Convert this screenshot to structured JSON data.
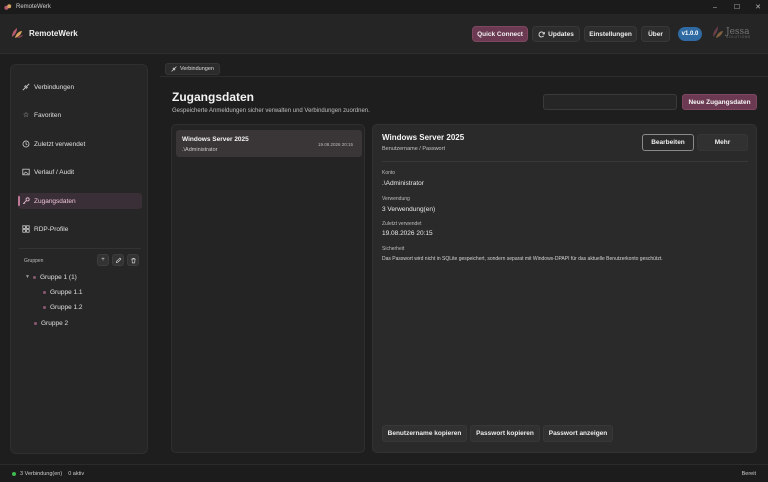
{
  "window": {
    "title": "RemoteWerk",
    "minimize": "–",
    "maximize": "☐",
    "close": "✕"
  },
  "header": {
    "brand": "RemoteWerk",
    "quick_connect": "Quick Connect",
    "updates": "Updates",
    "settings": "Einstellungen",
    "about": "Über",
    "version": "v1.0.0",
    "partner_logo_text": "Jessa",
    "partner_logo_sub": "SOLUTIONS"
  },
  "sidebar": {
    "items": [
      {
        "label": "Verbindungen",
        "icon": "plug-icon"
      },
      {
        "label": "Favoriten",
        "icon": "star-icon"
      },
      {
        "label": "Zuletzt verwendet",
        "icon": "history-icon"
      },
      {
        "label": "Verlauf / Audit",
        "icon": "image-icon"
      },
      {
        "label": "Zugangsdaten",
        "icon": "key-icon",
        "active": true
      },
      {
        "label": "RDP-Profile",
        "icon": "grid-icon"
      }
    ],
    "groups_label": "Gruppen",
    "group_actions": {
      "add": "+",
      "edit": "✎",
      "delete": "🗑"
    },
    "tree": [
      {
        "label": "Gruppe 1 (1)"
      },
      {
        "label": "Gruppe 1.1"
      },
      {
        "label": "Gruppe 1.2"
      },
      {
        "label": "Gruppe 2"
      }
    ]
  },
  "tabs": [
    {
      "label": "Verbindungen"
    }
  ],
  "main": {
    "title": "Zugangsdaten",
    "subtitle": "Gespeicherte Anmeldungen sicher verwalten und Verbindungen zuordnen.",
    "search_value": "",
    "new_button": "Neue Zugangsdaten"
  },
  "list": [
    {
      "name": "Windows Server 2025",
      "user": ".\\Administrator",
      "date": "19.08.2026 20:15"
    }
  ],
  "detail": {
    "title": "Windows Server 2025",
    "subtitle": "Benutzername / Passwort",
    "edit": "Bearbeiten",
    "more": "Mehr",
    "fields": {
      "account_label": "Konto",
      "account_value": ".\\Administrator",
      "usage_label": "Verwendung",
      "usage_value": "3  Verwendung(en)",
      "last_used_label": "Zuletzt verwendet",
      "last_used_value": "19.08.2026 20:15",
      "security_label": "Sicherheit",
      "security_value": "Das Passwort wird nicht in SQLite gespeichert, sondern separat mit Windows-DPAPI für das aktuelle Benutzerkonto geschützt."
    },
    "actions": {
      "copy_user": "Benutzername kopieren",
      "copy_password": "Passwort kopieren",
      "show_password": "Passwort anzeigen"
    }
  },
  "status": {
    "connections": "3 Verbindung(en)",
    "active": "0 aktiv",
    "state": "Bereit"
  },
  "colors": {
    "accent": "#6b3a52",
    "accent_text": "#f0c3da",
    "version_badge": "#2f6aa3",
    "status_ok": "#3fb950"
  }
}
